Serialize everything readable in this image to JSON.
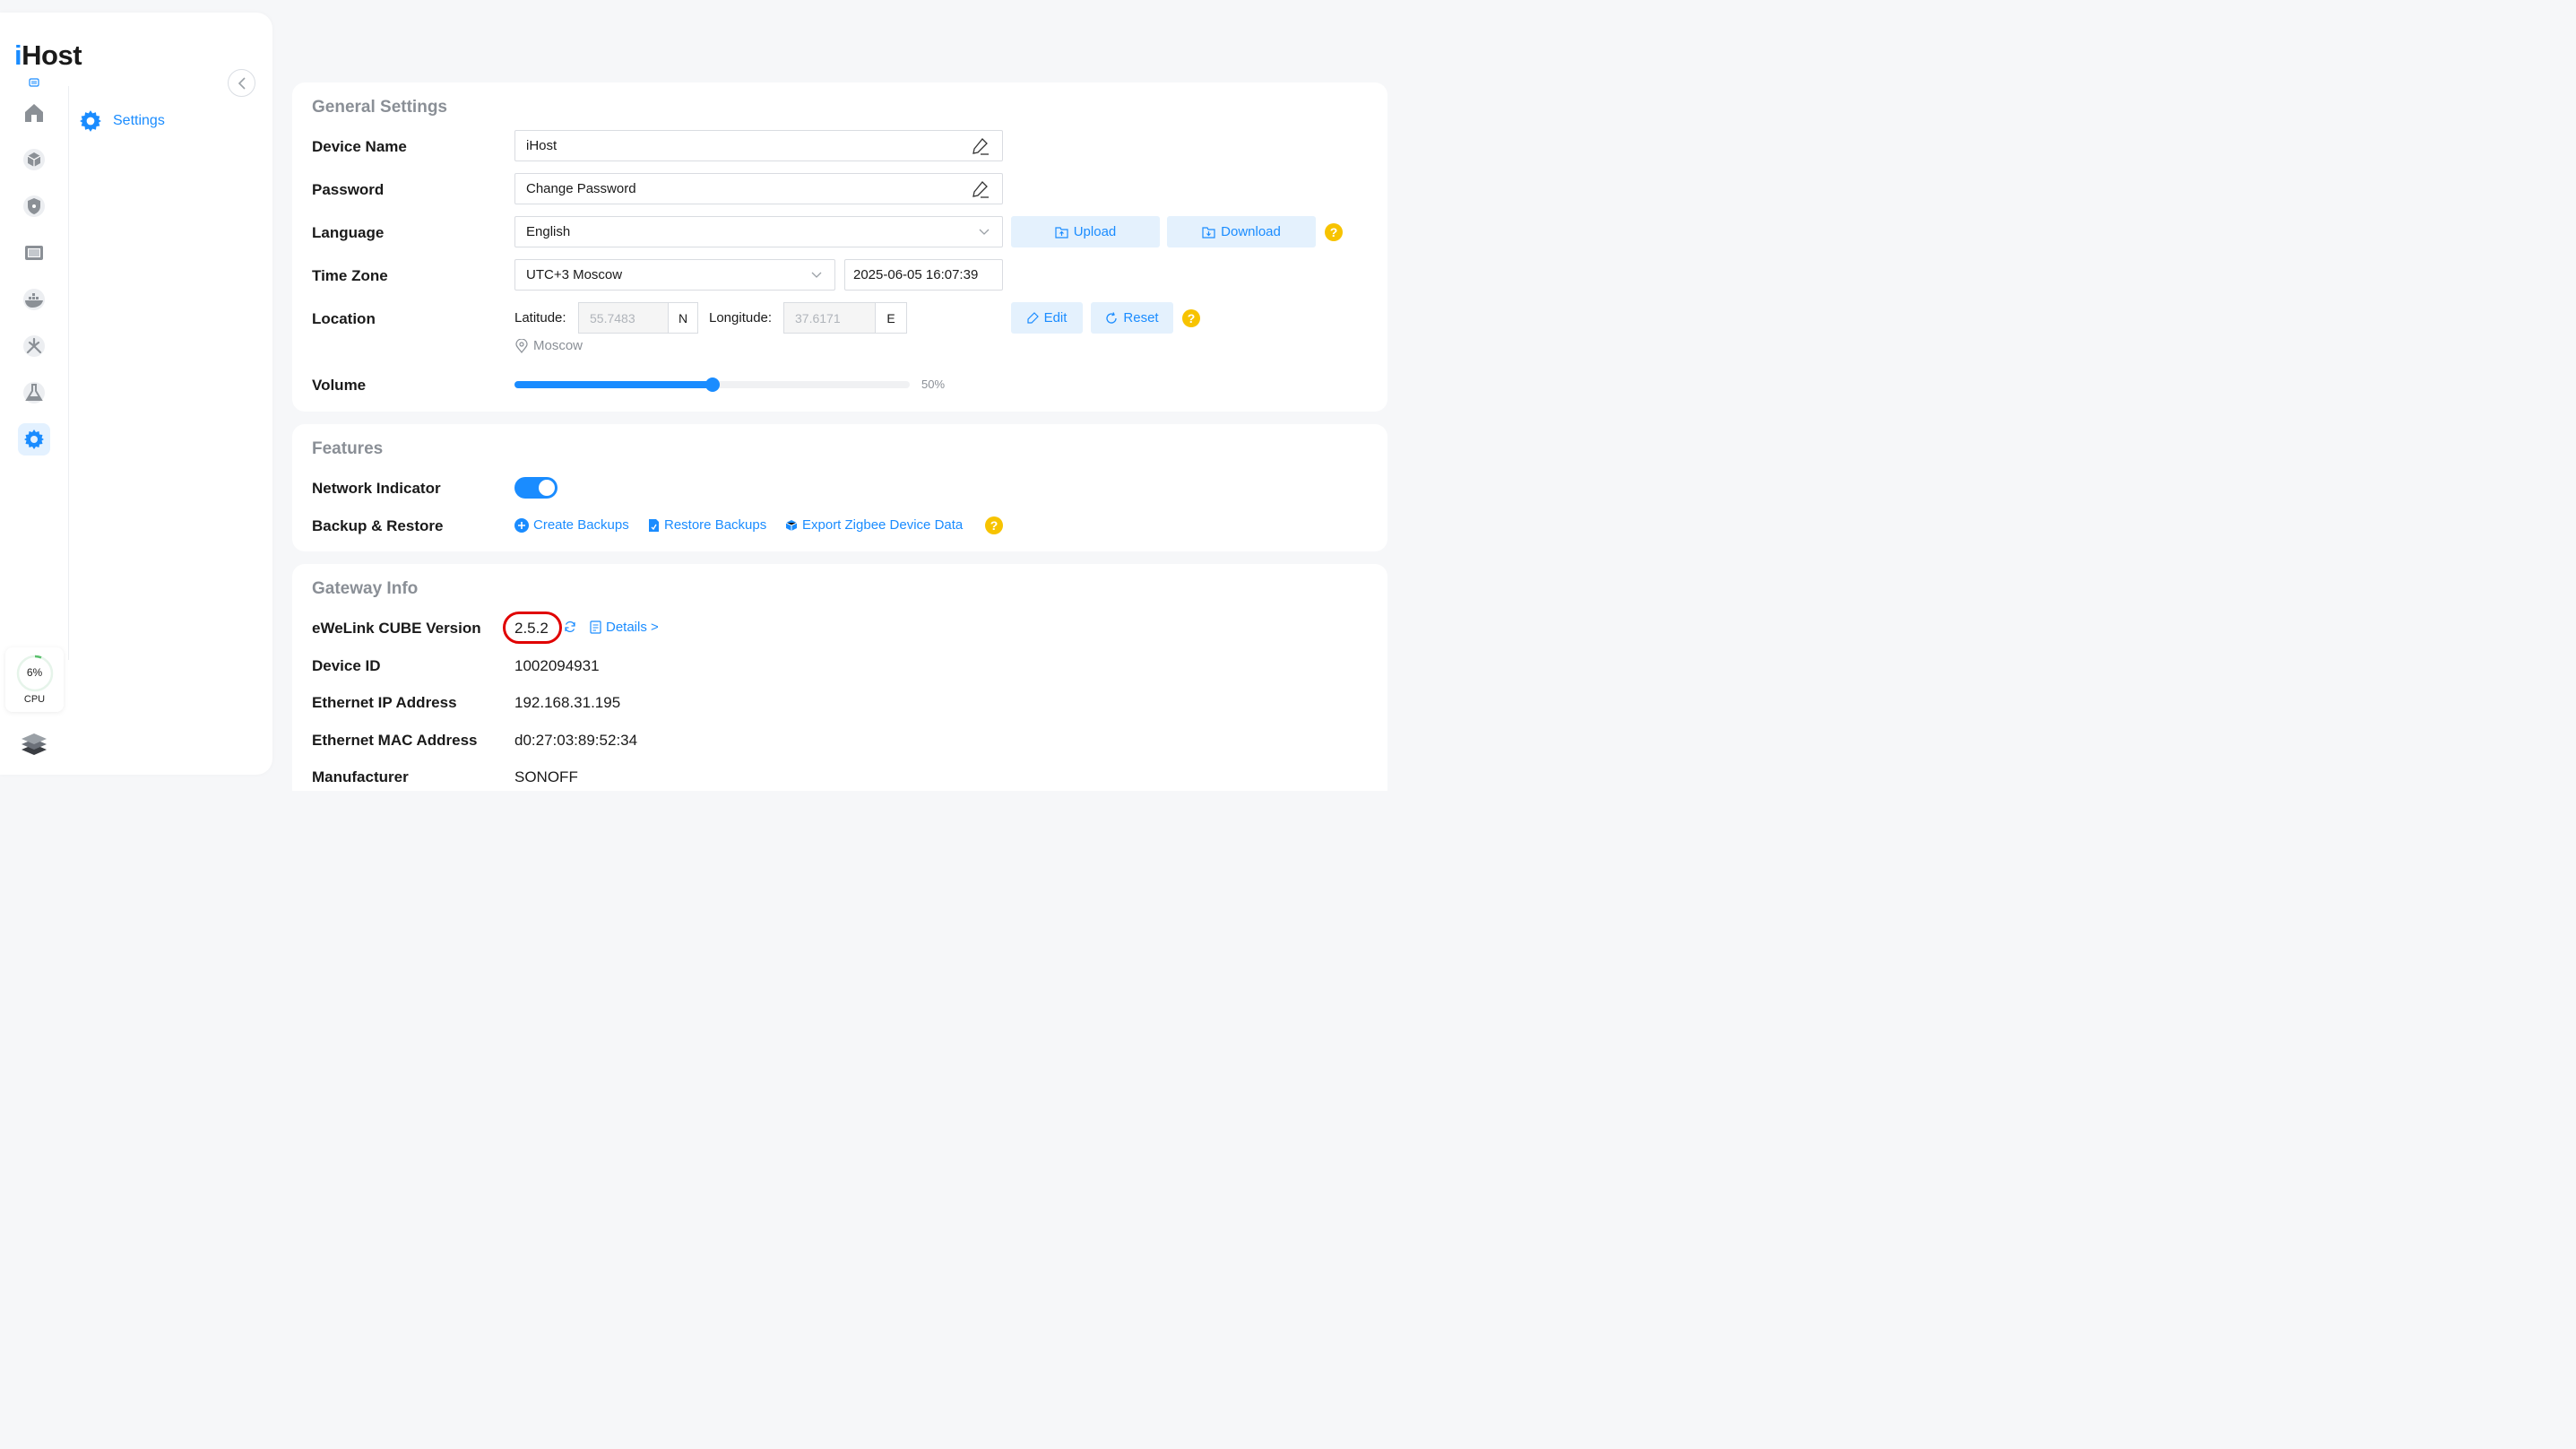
{
  "app": {
    "logo_first": "i",
    "logo_rest": "Host"
  },
  "sidebar": {
    "rail_icons": [
      "home-icon",
      "cube-icon",
      "shield-icon",
      "display-icon",
      "docker-icon",
      "automation-icon",
      "lab-flask-icon",
      "gear-icon"
    ],
    "active": "gear-icon",
    "submenu_label": "Settings",
    "cpu": {
      "value": "6%",
      "label": "CPU",
      "fraction": 0.06
    }
  },
  "general": {
    "title": "General Settings",
    "device_name_label": "Device Name",
    "device_name_value": "iHost",
    "password_label": "Password",
    "password_value": "Change Password",
    "language_label": "Language",
    "language_value": "English",
    "upload_label": "Upload",
    "download_label": "Download",
    "timezone_label": "Time Zone",
    "timezone_value": "UTC+3 Moscow",
    "datetime_value": "2025-06-05 16:07:39",
    "location_label": "Location",
    "latitude_label": "Latitude:",
    "latitude_value": "55.7483",
    "latitude_dir": "N",
    "longitude_label": "Longitude:",
    "longitude_value": "37.6171",
    "longitude_dir": "E",
    "edit_label": "Edit",
    "reset_label": "Reset",
    "city": "Moscow",
    "volume_label": "Volume",
    "volume_text": "50%",
    "volume_fraction": 0.5
  },
  "features": {
    "title": "Features",
    "network_label": "Network Indicator",
    "network_on": true,
    "backup_label": "Backup & Restore",
    "create_backups": "Create Backups",
    "restore_backups": "Restore Backups",
    "export_zigbee": "Export Zigbee Device Data"
  },
  "gateway": {
    "title": "Gateway Info",
    "version_label": "eWeLink CUBE Version",
    "version_value": "2.5.2",
    "details_label": "Details >",
    "device_id_label": "Device ID",
    "device_id_value": "1002094931",
    "ip_label": "Ethernet IP Address",
    "ip_value": "192.168.31.195",
    "mac_label": "Ethernet MAC Address",
    "mac_value": "d0:27:03:89:52:34",
    "manufacturer_label": "Manufacturer",
    "manufacturer_value": "SONOFF"
  },
  "colors": {
    "accent": "#1a8cff",
    "accent_light": "#e4f1fd",
    "help": "#f7c300",
    "highlight": "#e00000"
  }
}
